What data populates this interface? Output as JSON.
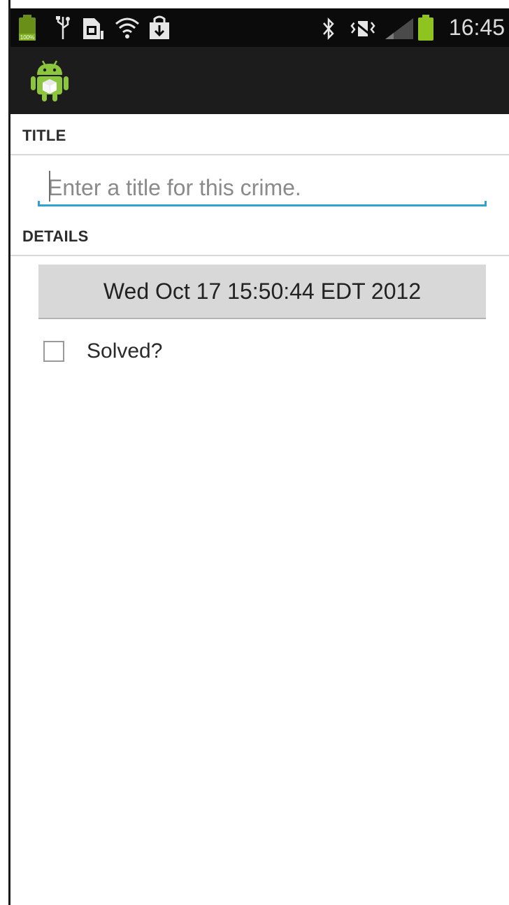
{
  "status_bar": {
    "time": "16:45",
    "battery_label": "100%",
    "icons": [
      "battery-icon",
      "usb-icon",
      "sim-icon",
      "wifi-icon",
      "download-icon",
      "bluetooth-icon",
      "mute-icon",
      "signal-icon",
      "battery-full-icon"
    ]
  },
  "action_bar": {
    "app_icon": "android-app-icon"
  },
  "sections": {
    "title_header": "TITLE",
    "details_header": "DETAILS"
  },
  "title_field": {
    "value": "",
    "placeholder": "Enter a title for this crime."
  },
  "date_button": {
    "label": "Wed Oct 17 15:50:44 EDT 2012"
  },
  "solved_checkbox": {
    "label": "Solved?",
    "checked": false
  },
  "colors": {
    "status_bar": "#0b0b0b",
    "action_bar": "#1c1c1c",
    "accent": "#2ea3d3",
    "battery_green": "#8fc320",
    "button_gray": "#d8d8d8"
  }
}
